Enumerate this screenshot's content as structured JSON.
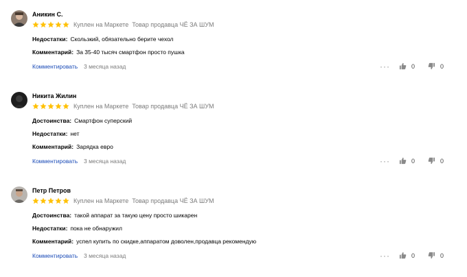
{
  "labels": {
    "pros": "Достоинства:",
    "cons": "Недостатки:",
    "comment": "Комментарий:",
    "reply": "Комментировать",
    "more": "···"
  },
  "colors": {
    "star": "#ffc107",
    "link": "#1a4bb7",
    "muted": "#7a7a7a"
  },
  "icons": {
    "rating": "star-icon",
    "like": "thumb-up-icon",
    "dislike": "thumb-down-icon",
    "more": "more-dots-icon"
  },
  "reviews": [
    {
      "author": "Аникин С.",
      "rating": 5,
      "purchase": "Куплен на Маркете",
      "seller": "Товар продавца ЧЁ ЗА ШУМ",
      "cons": "Скользкий, обязательно берите чехол",
      "comment": "За 35-40 тысяч смартфон просто пушка",
      "date": "3 месяца назад",
      "likes": "0",
      "dislikes": "0"
    },
    {
      "author": "Никита Жилин",
      "rating": 5,
      "purchase": "Куплен на Маркете",
      "seller": "Товар продавца ЧЁ ЗА ШУМ",
      "pros": "Смартфон суперский",
      "cons": "нет",
      "comment": "Зарядка евро",
      "date": "3 месяца назад",
      "likes": "0",
      "dislikes": "0"
    },
    {
      "author": "Петр Петров",
      "rating": 5,
      "purchase": "Куплен на Маркете",
      "seller": "Товар продавца ЧЁ ЗА ШУМ",
      "pros": "такой аппарат за такую цену просто шикарен",
      "cons": "пока не обнаружил",
      "comment": "успел купить по скидке,аппаратом доволен,продавца рекомендую",
      "date": "3 месяца назад",
      "likes": "0",
      "dislikes": "0"
    }
  ]
}
